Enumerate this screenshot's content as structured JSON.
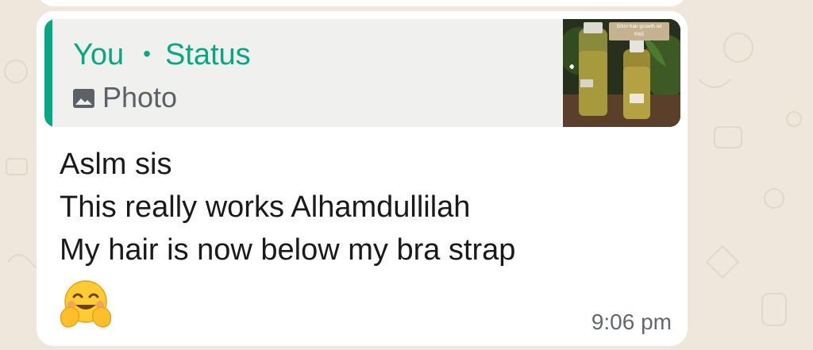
{
  "quoted_status": {
    "author": "You",
    "separator": "•",
    "label": "Status",
    "media_icon": "photo-icon",
    "media_type": "Photo",
    "thumbnail_text": [
      "50ml hair growth oil",
      "R65"
    ]
  },
  "message": {
    "lines": [
      "Aslm sis",
      "This really works Alhamdullilah",
      "My hair is now below my bra strap"
    ],
    "emoji": "hugging-face-emoji",
    "time": "9:06 pm"
  },
  "colors": {
    "accent": "#06a884",
    "bubble": "#ffffff",
    "quote_bg": "#f0f1ee",
    "chat_bg": "#efe7dc"
  }
}
